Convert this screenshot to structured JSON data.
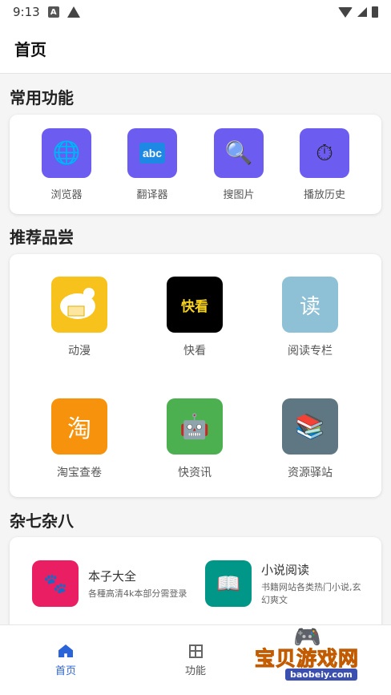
{
  "status": {
    "time": "9:13",
    "icons": [
      "notification-a-icon",
      "warning-icon",
      "wifi-icon",
      "signal-icon",
      "battery-icon"
    ]
  },
  "appbar": {
    "title": "首页"
  },
  "common": {
    "title": "常用功能",
    "items": [
      {
        "label": "浏览器",
        "icon": "globe-icon",
        "glyph": "🌐"
      },
      {
        "label": "翻译器",
        "icon": "abc-icon",
        "glyph": "abc"
      },
      {
        "label": "搜图片",
        "icon": "magnifier-icon",
        "glyph": "🔍"
      },
      {
        "label": "播放历史",
        "icon": "stopwatch-icon",
        "glyph": "⏱"
      }
    ]
  },
  "recommend": {
    "title": "推荐品尝",
    "items": [
      {
        "label": "动漫",
        "icon": "anime-icon",
        "color": "#f7c21b",
        "glyph": ""
      },
      {
        "label": "快看",
        "icon": "kuaikan-icon",
        "color": "#000000",
        "glyph": "快看"
      },
      {
        "label": "阅读专栏",
        "icon": "read-icon",
        "color": "#8ec0d6",
        "glyph": "读"
      },
      {
        "label": "淘宝查卷",
        "icon": "taobao-icon",
        "color": "#f7920c",
        "glyph": "淘"
      },
      {
        "label": "快资讯",
        "icon": "robot-icon",
        "color": "#4caf50",
        "glyph": "🤖"
      },
      {
        "label": "资源驿站",
        "icon": "books-icon",
        "color": "#5f7782",
        "glyph": "📚"
      }
    ]
  },
  "misc": {
    "title": "杂七杂八",
    "items": [
      {
        "title": "本子大全",
        "desc": "各種高清4k本部分需登录",
        "icon": "paw-icon",
        "color": "#e91e63",
        "glyph": "🐾"
      },
      {
        "title": "小说阅读",
        "desc": "书籍网站各类热门小说,玄幻爽文",
        "icon": "open-book-icon",
        "color": "#009688",
        "glyph": "📖"
      }
    ]
  },
  "nav": {
    "home": "首页",
    "features": "功能"
  },
  "watermark": {
    "text": "宝贝游戏网",
    "sub": "baobeiy.com"
  },
  "colors": {
    "accent": "#6c5cf0",
    "nav_active": "#2b63d9"
  }
}
